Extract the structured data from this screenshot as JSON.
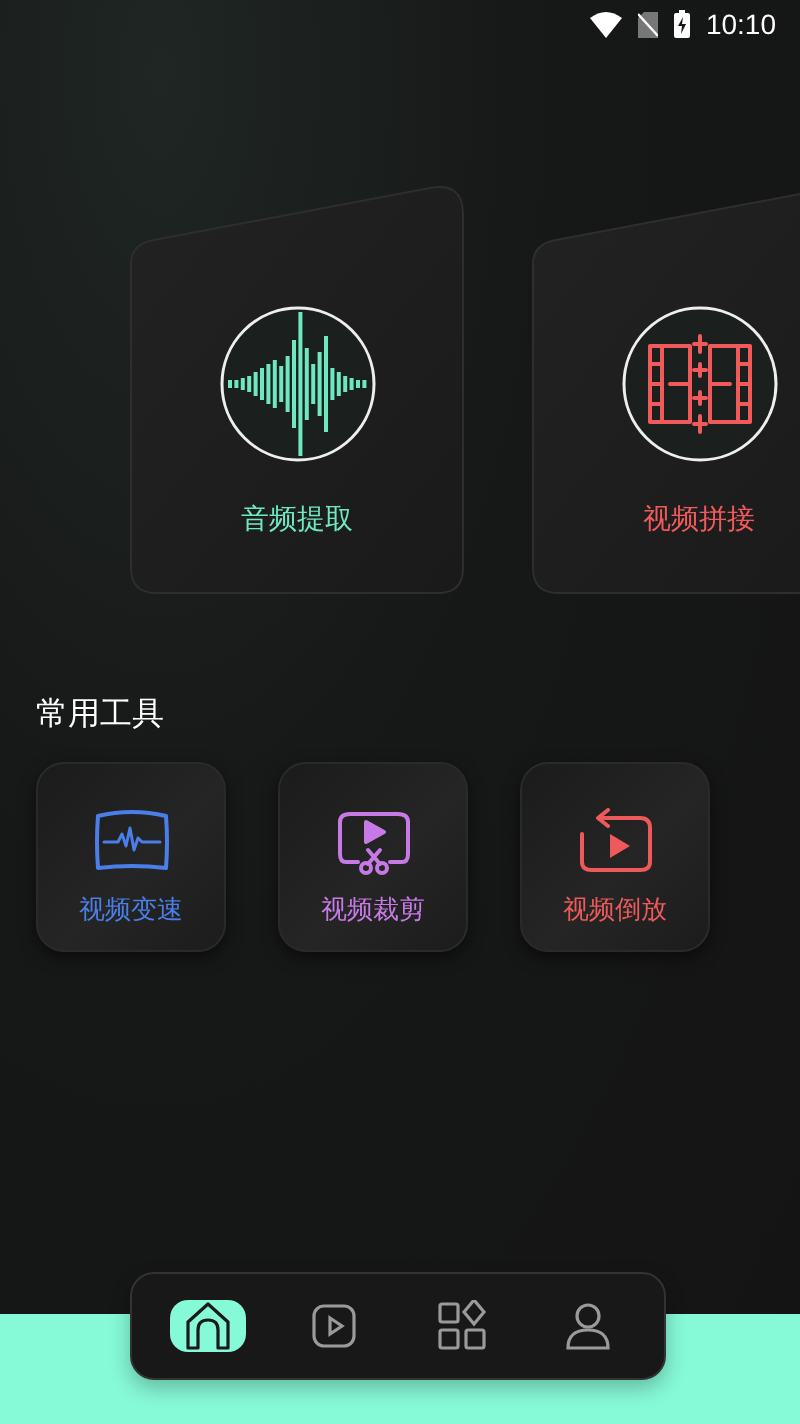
{
  "status_bar": {
    "time": "10:10"
  },
  "features": [
    {
      "label": "音频提取",
      "color": "#6de8c0",
      "kind": "waveform"
    },
    {
      "label": "视频拼接",
      "color": "#f05a5a",
      "kind": "film"
    }
  ],
  "tools_title": "常用工具",
  "tools": [
    {
      "label": "视频变速",
      "color": "#4a7ee8",
      "kind": "speed"
    },
    {
      "label": "视频裁剪",
      "color": "#c77ae6",
      "kind": "cut"
    },
    {
      "label": "视频倒放",
      "color": "#ee5a5a",
      "kind": "reverse"
    }
  ],
  "nav": [
    {
      "kind": "home",
      "selected": true
    },
    {
      "kind": "video",
      "selected": false
    },
    {
      "kind": "apps",
      "selected": false
    },
    {
      "kind": "user",
      "selected": false
    }
  ]
}
